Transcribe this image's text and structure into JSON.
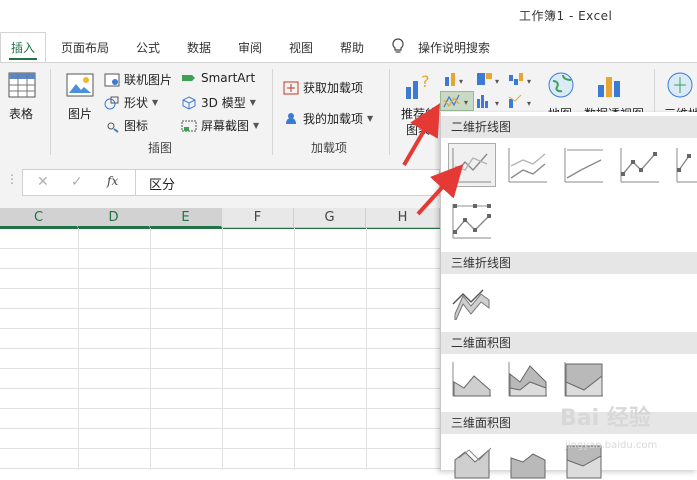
{
  "window": {
    "title": "工作簿1  -  Excel"
  },
  "tabs": [
    {
      "label": "插入"
    },
    {
      "label": "页面布局"
    },
    {
      "label": "公式"
    },
    {
      "label": "数据"
    },
    {
      "label": "审阅"
    },
    {
      "label": "视图"
    },
    {
      "label": "帮助"
    },
    {
      "label": "操作说明搜索"
    }
  ],
  "ribbon": {
    "table_label": "表格",
    "picture_label": "图片",
    "online_picture_label": "联机图片",
    "shapes_label": "形状",
    "icons_label": "图标",
    "smartart_label": "SmartArt",
    "model3d_label": "3D 模型",
    "screenshot_label": "屏幕截图",
    "illustrations_group": "插图",
    "get_addins_label": "获取加载项",
    "my_addins_label": "我的加载项",
    "addins_group": "加载项",
    "recommended_charts_line1": "推荐的",
    "recommended_charts_line2": "图表",
    "map_label": "地图",
    "pivotchart_label": "数据透视图",
    "threed_label": "三维地"
  },
  "formula_bar": {
    "fx": "fx",
    "value": "区分"
  },
  "grid": {
    "columns": [
      "C",
      "D",
      "E",
      "F",
      "G",
      "H"
    ],
    "selected_columns": [
      "C",
      "D",
      "E"
    ]
  },
  "gallery": {
    "sections": [
      {
        "title": "二维折线图"
      },
      {
        "title": "三维折线图"
      },
      {
        "title": "二维面积图"
      },
      {
        "title": "三维面积图"
      }
    ]
  },
  "watermark": {
    "text": "Bai 经验",
    "sub": "jingyan.baidu.com"
  },
  "colors": {
    "accent": "#217346",
    "arrow": "#e53935"
  }
}
